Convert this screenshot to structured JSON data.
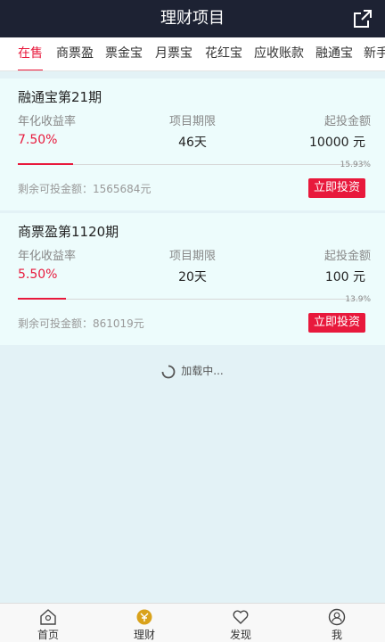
{
  "header": {
    "title": "理财项目",
    "share_icon": "share-icon"
  },
  "tabs": [
    {
      "label": "在售",
      "active": true
    },
    {
      "label": "商票盈",
      "active": false
    },
    {
      "label": "票金宝",
      "active": false
    },
    {
      "label": "月票宝",
      "active": false
    },
    {
      "label": "花红宝",
      "active": false
    },
    {
      "label": "应收账款",
      "active": false
    },
    {
      "label": "融通宝",
      "active": false
    },
    {
      "label": "新手",
      "active": false
    }
  ],
  "products": [
    {
      "name": "融通宝第21期",
      "rate_label": "年化收益率",
      "rate": "7.50%",
      "term_label": "项目期限",
      "term": "46天",
      "min_label": "起投金额",
      "min": "10000 元",
      "progress_text": "15.93%",
      "progress": 0.1593,
      "remaining": "剩余可投金额：1565684元",
      "invest_label": "立即投资"
    },
    {
      "name": "商票盈第1120期",
      "rate_label": "年化收益率",
      "rate": "5.50%",
      "term_label": "项目期限",
      "term": "20天",
      "min_label": "起投金额",
      "min": "100 元",
      "progress_text": "13.9%",
      "progress": 0.139,
      "remaining": "剩余可投金额：861019元",
      "invest_label": "立即投资"
    }
  ],
  "loading": {
    "text": "加载中..."
  },
  "tabbar": [
    {
      "label": "首页",
      "icon": "home-icon",
      "active": false
    },
    {
      "label": "理财",
      "icon": "finance-icon",
      "active": true
    },
    {
      "label": "发现",
      "icon": "heart-icon",
      "active": false
    },
    {
      "label": "我",
      "icon": "user-icon",
      "active": false
    }
  ],
  "colors": {
    "accent": "#e8193c",
    "header_bg": "#1d2233",
    "card_bg": "#edfcfc",
    "page_bg": "#e3f2f6",
    "tabbar_active_icon": "#d9a21b"
  }
}
